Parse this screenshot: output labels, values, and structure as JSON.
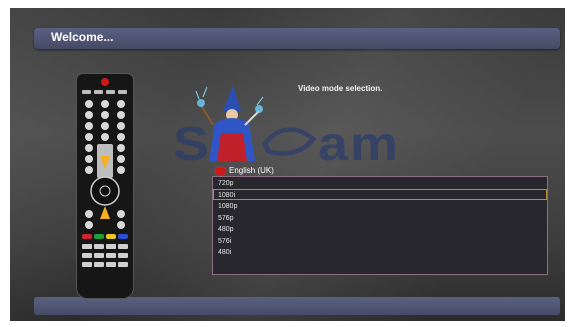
{
  "header": {
    "title": "Welcome..."
  },
  "main": {
    "prompt": "Video mode selection.",
    "language": "English (UK)",
    "logo_text": "SPYCAM",
    "video_modes": [
      "720p",
      "1080i",
      "1080p",
      "576p",
      "480p",
      "576i",
      "480i"
    ],
    "selected_mode": "1080i"
  },
  "colors": {
    "bar": "#4a5070",
    "selection": "#b78a3c",
    "list_bg": "#27272d",
    "red_button": "#d01818",
    "arrow": "#f5b021"
  }
}
